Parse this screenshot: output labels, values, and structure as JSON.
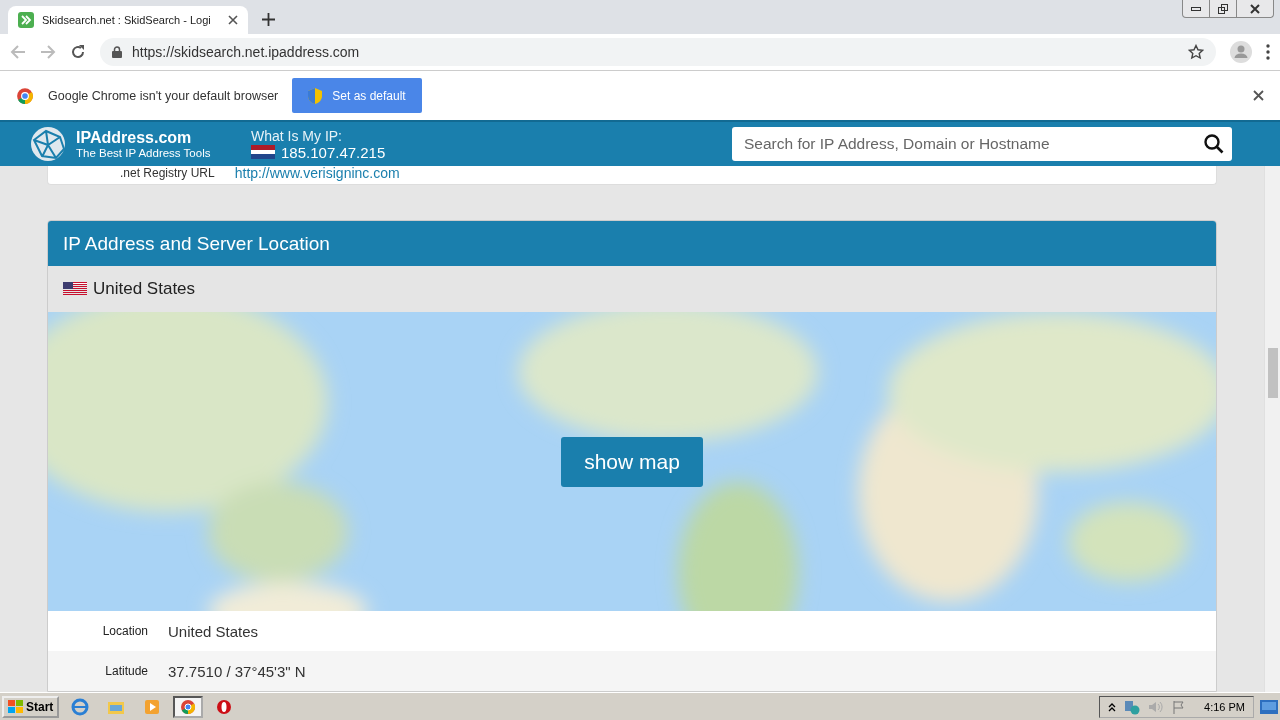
{
  "browser": {
    "tab_title": "Skidsearch.net : SkidSearch - Logi",
    "address": "https://skidsearch.net.ipaddress.com"
  },
  "infobar": {
    "message": "Google Chrome isn't your default browser",
    "button": "Set as default"
  },
  "site_header": {
    "logo_title": "IPAddress.com",
    "logo_subtitle": "The Best IP Address Tools",
    "ip_label": "What Is My IP:",
    "ip": "185.107.47.215",
    "search_placeholder": "Search for IP Address, Domain or Hostname"
  },
  "registry_row": {
    "label": ".net Registry URL",
    "value": "http://www.verisigninc.com"
  },
  "location_panel": {
    "title": "IP Address and Server Location",
    "country": "United States",
    "map_button": "show map",
    "rows": [
      {
        "label": "Location",
        "value": "United States"
      },
      {
        "label": "Latitude",
        "value": "37.7510 / 37°45'3\" N"
      }
    ]
  },
  "taskbar": {
    "start": "Start",
    "time": "4:16 PM",
    "apps": [
      {
        "selected": false
      },
      {
        "selected": false
      },
      {
        "selected": false
      },
      {
        "selected": true
      },
      {
        "selected": false
      }
    ]
  }
}
